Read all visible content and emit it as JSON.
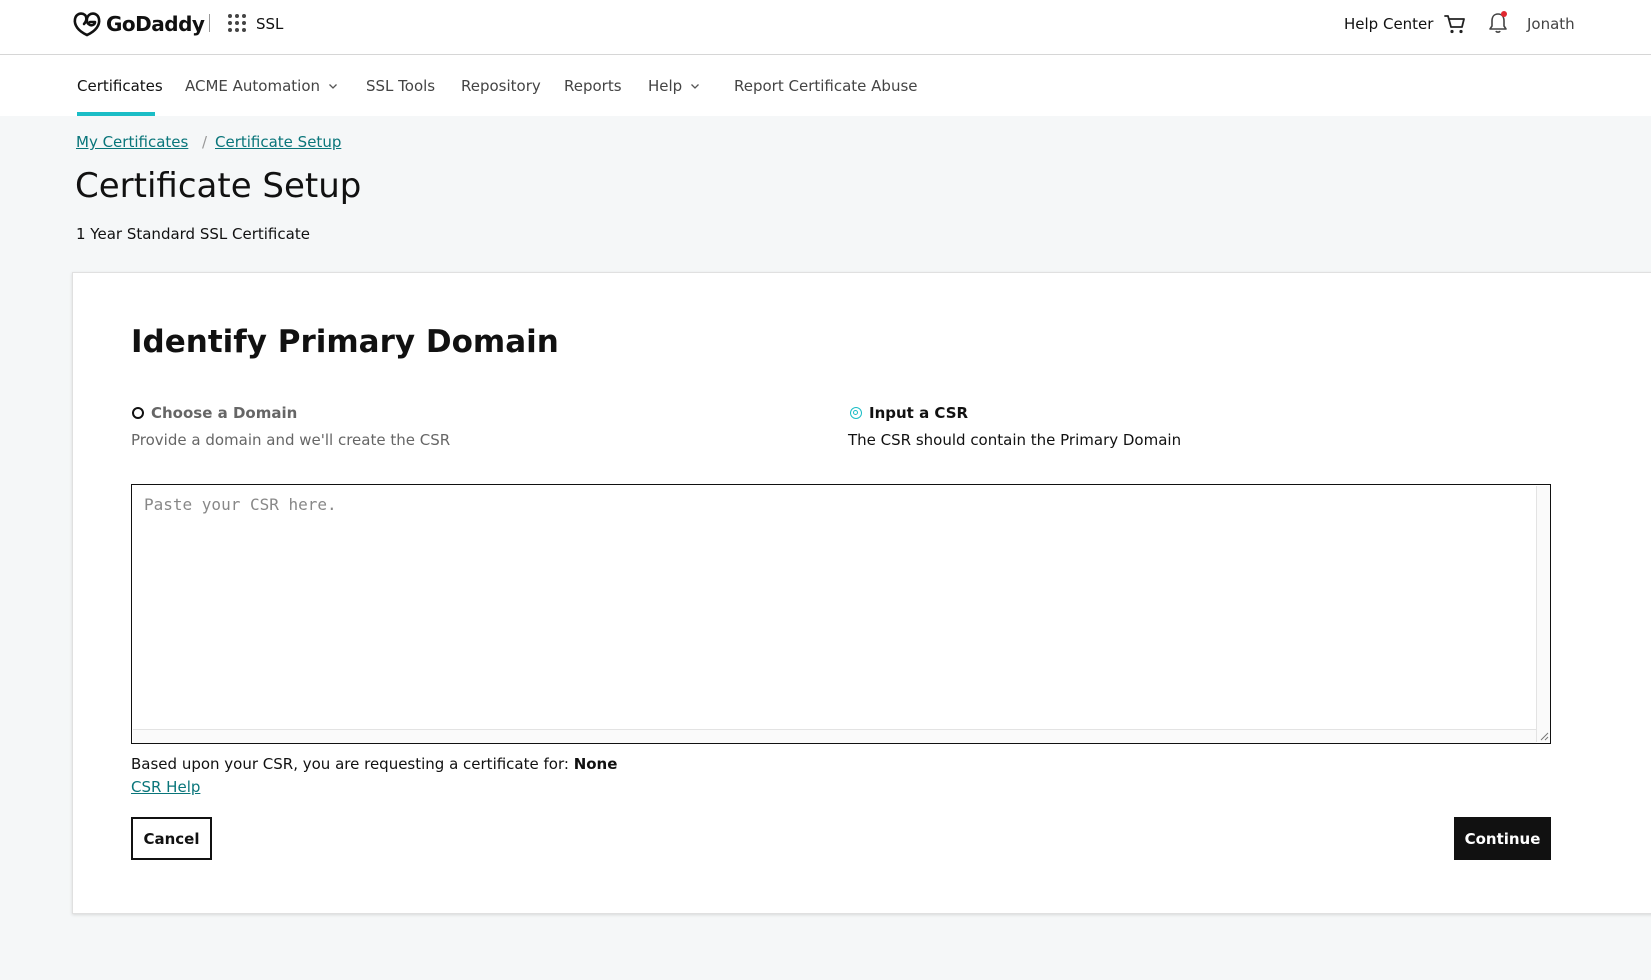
{
  "header": {
    "brand": "GoDaddy",
    "product": "SSL",
    "help_center": "Help Center",
    "user_name": "Jonath",
    "notification_dot_color": "#e0282f",
    "icons": [
      "godaddy-logo-icon",
      "apps-grid-icon",
      "cart-icon",
      "bell-icon"
    ]
  },
  "nav": {
    "items": [
      {
        "label": "Certificates",
        "active": true
      },
      {
        "label": "ACME Automation",
        "has_dropdown": true
      },
      {
        "label": "SSL Tools"
      },
      {
        "label": "Repository"
      },
      {
        "label": "Reports"
      },
      {
        "label": "Help",
        "has_dropdown": true
      },
      {
        "label": "Report Certificate Abuse"
      }
    ],
    "accent_color": "#1bbdc6"
  },
  "breadcrumb": {
    "items": [
      "My Certificates",
      "Certificate Setup"
    ],
    "separator": "/"
  },
  "page": {
    "title": "Certificate Setup",
    "subtitle": "1 Year Standard SSL Certificate"
  },
  "form": {
    "title": "Identify Primary Domain",
    "options": [
      {
        "label": "Choose a Domain",
        "description": "Provide a domain and we'll create the CSR",
        "selected": false
      },
      {
        "label": "Input a CSR",
        "description": "The CSR should contain the Primary Domain",
        "selected": true
      }
    ],
    "csr": {
      "placeholder": "Paste your CSR here.",
      "value": ""
    },
    "request_prefix": "Based upon your CSR, you are requesting a certificate for:",
    "request_value": "None",
    "csr_help": "CSR Help",
    "cancel": "Cancel",
    "continue": "Continue"
  }
}
